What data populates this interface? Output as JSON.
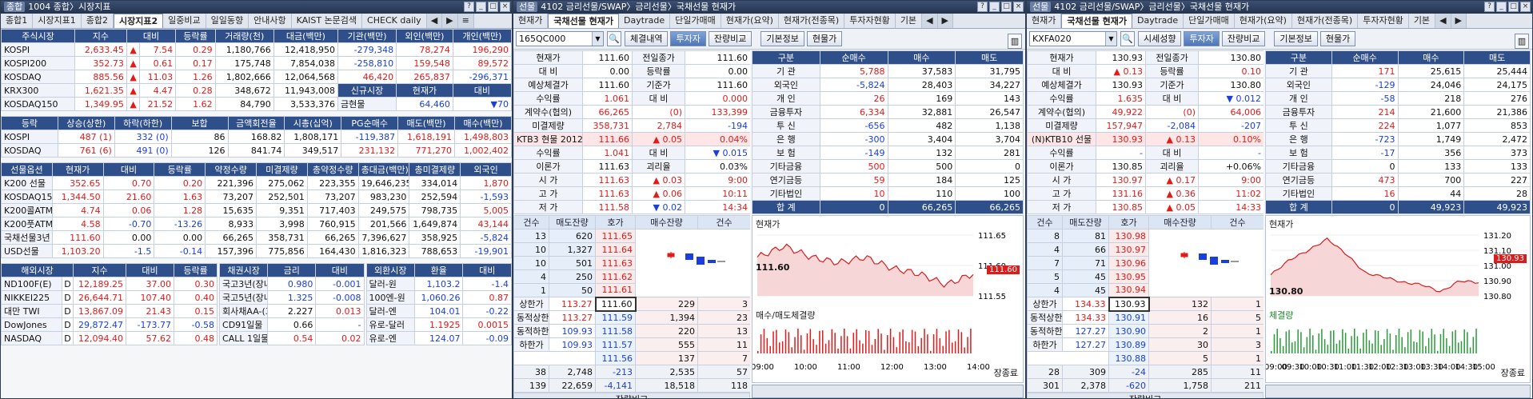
{
  "w1": {
    "badge": "종합",
    "title": "1004 종합〉시장지표",
    "tabs": [
      "종합1",
      "시장지표1",
      "종합2",
      "시장지표2",
      "일중비교",
      "일일동향",
      "안내사항",
      "KAIST 논문검색",
      "CHECK daily"
    ],
    "active_tab": 3,
    "market": {
      "headers": [
        "주식시장",
        "지수",
        "대비",
        "등락률",
        "거래량(천)",
        "대금(백만)",
        "기관(백만)",
        "외인(백만)",
        "개인(백만)"
      ],
      "rows": [
        [
          "KOSPI",
          "2,633.45",
          "▲",
          "7.54",
          "0.29",
          "1,180,766",
          "12,418,950",
          "-279,348",
          "78,274",
          "196,290"
        ],
        [
          "KOSPI200",
          "352.73",
          "▲",
          "0.61",
          "0.17",
          "175,748",
          "7,854,038",
          "-258,810",
          "159,548",
          "89,572"
        ],
        [
          "KOSDAQ",
          "885.56",
          "▲",
          "11.03",
          "1.26",
          "1,802,666",
          "12,064,568",
          "46,420",
          "265,837",
          "-296,371"
        ],
        [
          "KRX300",
          "1,621.35",
          "▲",
          "4.47",
          "0.28",
          "348,672",
          "11,943,008",
          "신규시장",
          "현재가",
          "대비"
        ],
        [
          "KOSDAQ150",
          "1,349.95",
          "▲",
          "21.52",
          "1.62",
          "84,790",
          "3,533,376",
          "금현물",
          "64,460",
          "▼70"
        ]
      ]
    },
    "updown": {
      "headers": [
        "등락",
        "상승(상한)",
        "하락(하한)",
        "보합",
        "금액회전율",
        "시총(십억)",
        "PG순매수",
        "매도(백만)",
        "매수(백만)"
      ],
      "rows": [
        [
          "KOSPI",
          "487 (1)",
          "332 (0)",
          "86",
          "168.82",
          "1,808,171",
          "-119,387",
          "1,618,191",
          "1,498,803"
        ],
        [
          "KOSDAQ",
          "761 (6)",
          "491 (0)",
          "126",
          "841.74",
          "349,517",
          "231,132",
          "771,270",
          "1,002,402"
        ]
      ]
    },
    "futopt": {
      "headers": [
        "선물옵션",
        "현재가",
        "대비",
        "등락률",
        "약정수량",
        "미결제량",
        "총약정수량",
        "총대금(백만)",
        "총미결제량",
        "외국인"
      ],
      "rows": [
        [
          "K200 선물",
          "352.65",
          "0.70",
          "0.20",
          "221,396",
          "275,062",
          "223,355",
          "19,646,235",
          "334,014",
          "1,870"
        ],
        [
          "KOSDAQ150 선물",
          "1,344.50",
          "21.60",
          "1.63",
          "73,207",
          "252,501",
          "73,207",
          "983,230",
          "252,594",
          "-1,593"
        ],
        [
          "K200콜ATM",
          "4.74",
          "0.06",
          "1.28",
          "15,635",
          "9,351",
          "717,403",
          "249,575",
          "798,735",
          "5,005"
        ],
        [
          "K200풋ATM",
          "4.58",
          "-0.70",
          "-13.26",
          "8,933",
          "3,998",
          "760,915",
          "201,566",
          "1,649,874",
          "43,144"
        ],
        [
          "국채선물3년",
          "111.60",
          "0.00",
          "0.00",
          "66,265",
          "358,731",
          "66,265",
          "7,396,627",
          "358,925",
          "-5,824"
        ],
        [
          "USD선물",
          "1,103.20",
          "-1.5",
          "-0.14",
          "157,396",
          "775,856",
          "164,430",
          "1,816,323",
          "788,653",
          "-19,901"
        ]
      ]
    },
    "overseas": {
      "headers": [
        "해외시장",
        "지수",
        "대비",
        "등락률"
      ],
      "rows": [
        [
          "ND100F(E)",
          "D",
          "12,189.25",
          "37.00",
          "0.30"
        ],
        [
          "NIKKEI225",
          "D",
          "26,644.71",
          "107.40",
          "0.40"
        ],
        [
          "대만 TWI",
          "D",
          "13,867.09",
          "21.43",
          "0.15"
        ],
        [
          "DowJones",
          "D",
          "29,872.47",
          "-173.77",
          "-0.58"
        ],
        [
          "NASDAQ",
          "D",
          "12,094.40",
          "57.62",
          "0.48"
        ]
      ]
    },
    "bond": {
      "headers": [
        "채권시장",
        "금리",
        "대비"
      ],
      "rows": [
        [
          "국고3년(장내)",
          "0.980",
          "-0.001"
        ],
        [
          "국고5년(장내)",
          "1.325",
          "-0.008"
        ],
        [
          "회사채AA-(3)",
          "2.227",
          "0.013"
        ],
        [
          "CD91일물",
          "0.66",
          "-"
        ],
        [
          "CALL 1일물",
          "0.54",
          "0.02"
        ]
      ]
    },
    "fx": {
      "headers": [
        "외환시장",
        "환율",
        "대비"
      ],
      "rows": [
        [
          "달러-원",
          "1,103.2",
          "-1.4"
        ],
        [
          "100엔-원",
          "1,060.26",
          "0.87"
        ],
        [
          "달러-엔",
          "104.01",
          "-0.22"
        ],
        [
          "유로-달러",
          "1.1925",
          "0.0015"
        ],
        [
          "유로-엔",
          "124.07",
          "-0.09"
        ]
      ]
    }
  },
  "w2": {
    "badge": "선물",
    "title": "4102 금리선물/SWAP〉금리선물〉국채선물 현재가",
    "tabs": [
      "현재가",
      "국채선물 현재가",
      "Daytrade",
      "단일가매매",
      "현재가(요약)",
      "현재가(전종목)",
      "투자자현황",
      "기본"
    ],
    "active_tab": 1,
    "code": "165QC000",
    "buttons": [
      "체결내역",
      "투자자",
      "잔량비교",
      "기본정보",
      "현물가"
    ],
    "sel_btn": 1,
    "info": [
      [
        "현재가",
        "111.60",
        "전일종가",
        "111.60"
      ],
      [
        "대 비",
        "0.00",
        "등락률",
        "0.00"
      ],
      [
        "예상체결가",
        "111.60",
        "기준가",
        "111.60"
      ],
      [
        "수익률",
        "1.061",
        "대 비",
        "0.000"
      ],
      [
        "계약수(협의)",
        "66,265",
        "(0)",
        "133,399"
      ],
      [
        "미결제량",
        "358,731",
        "2,784",
        "-194"
      ],
      [
        "KTB3 현물 2012",
        "111.66",
        "▲ 0.05",
        "0.04%"
      ],
      [
        "수익률",
        "1.041",
        "대 비",
        "▼ 0.015"
      ],
      [
        "이론가",
        "111.63",
        "괴리율",
        "0.03%"
      ],
      [
        "시 가",
        "111.63",
        "▲ 0.03",
        "9:00"
      ],
      [
        "고 가",
        "111.63",
        "▲ 0.06",
        "10:11"
      ],
      [
        "저 가",
        "111.58",
        "▼ 0.02",
        "14:34"
      ]
    ],
    "inv_headers": [
      "구분",
      "순매수",
      "매수",
      "매도"
    ],
    "investors": [
      [
        "기 관",
        "5,788",
        "37,583",
        "31,795"
      ],
      [
        "외국인",
        "-5,824",
        "28,403",
        "34,227"
      ],
      [
        "개 인",
        "26",
        "169",
        "143"
      ],
      [
        "금융투자",
        "6,334",
        "32,881",
        "26,547"
      ],
      [
        "투 신",
        "-656",
        "482",
        "1,138"
      ],
      [
        "은 행",
        "-300",
        "3,404",
        "3,704"
      ],
      [
        "보 험",
        "-149",
        "132",
        "281"
      ],
      [
        "기타금융",
        "500",
        "500",
        "0"
      ],
      [
        "연기금등",
        "59",
        "184",
        "125"
      ],
      [
        "기타법인",
        "10",
        "110",
        "100"
      ],
      [
        "합 계",
        "0",
        "66,265",
        "66,265"
      ]
    ],
    "ob_headers": [
      "건수",
      "매도잔량",
      "호가",
      "매수잔량",
      "건수"
    ],
    "asks": [
      [
        "13",
        "620",
        "111.65"
      ],
      [
        "10",
        "1,327",
        "111.64"
      ],
      [
        "10",
        "501",
        "111.63"
      ],
      [
        "4",
        "250",
        "111.62"
      ],
      [
        "1",
        "50",
        "111.61"
      ]
    ],
    "limits": [
      [
        "상한가",
        "113.27"
      ],
      [
        "동적상한",
        "113.27"
      ],
      [
        "동적하한",
        "109.93"
      ],
      [
        "하한가",
        "109.93"
      ]
    ],
    "bids": [
      [
        "111.60",
        "229",
        "3"
      ],
      [
        "111.59",
        "1,394",
        "23"
      ],
      [
        "111.58",
        "220",
        "13"
      ],
      [
        "111.57",
        "555",
        "11"
      ],
      [
        "111.56",
        "137",
        "7"
      ]
    ],
    "totals": [
      [
        "38",
        "2,748",
        "-213",
        "2,535",
        "57"
      ],
      [
        "139",
        "22,659",
        "-4,141",
        "18,518",
        "118"
      ]
    ],
    "footer": "잔량비교",
    "chart": {
      "title": "현재가",
      "subtitle": "매수/매도체결량",
      "price": "111.60",
      "period": [
        "1W",
        "1M"
      ],
      "end": "장종료"
    }
  },
  "w3": {
    "badge": "선물",
    "title": "4102 금리선물/SWAP〉금리선물〉국채선물 현재가",
    "tabs": [
      "현재가",
      "국채선물 현재가",
      "Daytrade",
      "단일가매매",
      "현재가(요약)",
      "현재가(전종목)",
      "투자자현황",
      "기본"
    ],
    "active_tab": 1,
    "code": "KXFA020",
    "buttons": [
      "시세성향",
      "투자자",
      "잔량비교",
      "기본정보",
      "현물가"
    ],
    "sel_btn": 1,
    "info": [
      [
        "현재가",
        "130.93",
        "전일종가",
        "130.80"
      ],
      [
        "대 비",
        "▲ 0.13",
        "등락률",
        "0.10"
      ],
      [
        "예상체결가",
        "130.93",
        "기준가",
        "130.80"
      ],
      [
        "수익률",
        "1.635",
        "대 비",
        "▼ 0.012"
      ],
      [
        "계약수(협의)",
        "49,922",
        "(0)",
        "64,006"
      ],
      [
        "미결제량",
        "157,947",
        "-2,084",
        "-207"
      ],
      [
        "(N)KTB10 선물",
        "130.93",
        "▲ 0.13",
        "0.10%"
      ],
      [
        "수익률",
        "-",
        "대 비",
        "-"
      ],
      [
        "이론가",
        "130.85",
        "괴리율",
        "+0.06%"
      ],
      [
        "시 가",
        "130.97",
        "▲ 0.17",
        "9:00"
      ],
      [
        "고 가",
        "131.16",
        "▲ 0.36",
        "11:02"
      ],
      [
        "저 가",
        "130.85",
        "▲ 0.05",
        "14:33"
      ]
    ],
    "inv_headers": [
      "구분",
      "순매수",
      "매수",
      "매도"
    ],
    "investors": [
      [
        "기 관",
        "171",
        "25,615",
        "25,444"
      ],
      [
        "외국인",
        "-129",
        "24,046",
        "24,175"
      ],
      [
        "개 인",
        "-58",
        "218",
        "276"
      ],
      [
        "금융투자",
        "214",
        "21,600",
        "21,386"
      ],
      [
        "투 신",
        "224",
        "1,077",
        "853"
      ],
      [
        "은 행",
        "-723",
        "1,749",
        "2,472"
      ],
      [
        "보 험",
        "-17",
        "356",
        "373"
      ],
      [
        "기타금융",
        "0",
        "133",
        "133"
      ],
      [
        "연기금등",
        "473",
        "700",
        "227"
      ],
      [
        "기타법인",
        "16",
        "44",
        "28"
      ],
      [
        "합 계",
        "0",
        "49,923",
        "49,923"
      ]
    ],
    "ob_headers": [
      "건수",
      "매도잔량",
      "호가",
      "매수잔량",
      "건수"
    ],
    "asks": [
      [
        "8",
        "81",
        "130.98"
      ],
      [
        "4",
        "66",
        "130.97"
      ],
      [
        "7",
        "71",
        "130.96"
      ],
      [
        "5",
        "45",
        "130.95"
      ],
      [
        "4",
        "45",
        "130.94"
      ]
    ],
    "limits": [
      [
        "상한가",
        "134.33"
      ],
      [
        "동적상한",
        "134.33"
      ],
      [
        "동적하한",
        "127.27"
      ],
      [
        "하한가",
        "127.27"
      ]
    ],
    "bids": [
      [
        "130.93",
        "132",
        "1"
      ],
      [
        "130.91",
        "16",
        "5"
      ],
      [
        "130.90",
        "2",
        "1"
      ],
      [
        "130.89",
        "30",
        "3"
      ],
      [
        "130.88",
        "5",
        "1"
      ]
    ],
    "totals": [
      [
        "28",
        "309",
        "-24",
        "285",
        "11"
      ],
      [
        "301",
        "2,378",
        "-620",
        "1,758",
        "211"
      ]
    ],
    "footer": "잔량비교",
    "chart": {
      "title": "현재가",
      "subtitle": "체결량",
      "price": "130.93",
      "low": "130.80",
      "end": "장종료"
    }
  },
  "chart_data": [
    {
      "type": "line",
      "title": "현재가",
      "x": [
        "09:00",
        "10:00",
        "11:00",
        "12:00",
        "13:00",
        "14:00"
      ],
      "y_ticks": [
        "111.65",
        "111.60",
        "111.55"
      ],
      "values": [
        111.63,
        111.65,
        111.63,
        111.62,
        111.63,
        111.61,
        111.6,
        111.58,
        111.6
      ]
    },
    {
      "type": "line",
      "title": "현재가",
      "x": [
        "09:00",
        "09:30",
        "10:00",
        "10:30",
        "11:00",
        "11:30",
        "12:00",
        "12:30",
        "13:00",
        "13:30",
        "14:00",
        "14:30",
        "15:00"
      ],
      "y_ticks": [
        "131.20",
        "131.10",
        "131.00",
        "130.90",
        "130.80"
      ],
      "values": [
        130.97,
        131.05,
        131.1,
        131.16,
        131.08,
        130.98,
        130.96,
        130.93,
        130.92,
        130.88,
        130.94,
        130.93
      ]
    }
  ]
}
